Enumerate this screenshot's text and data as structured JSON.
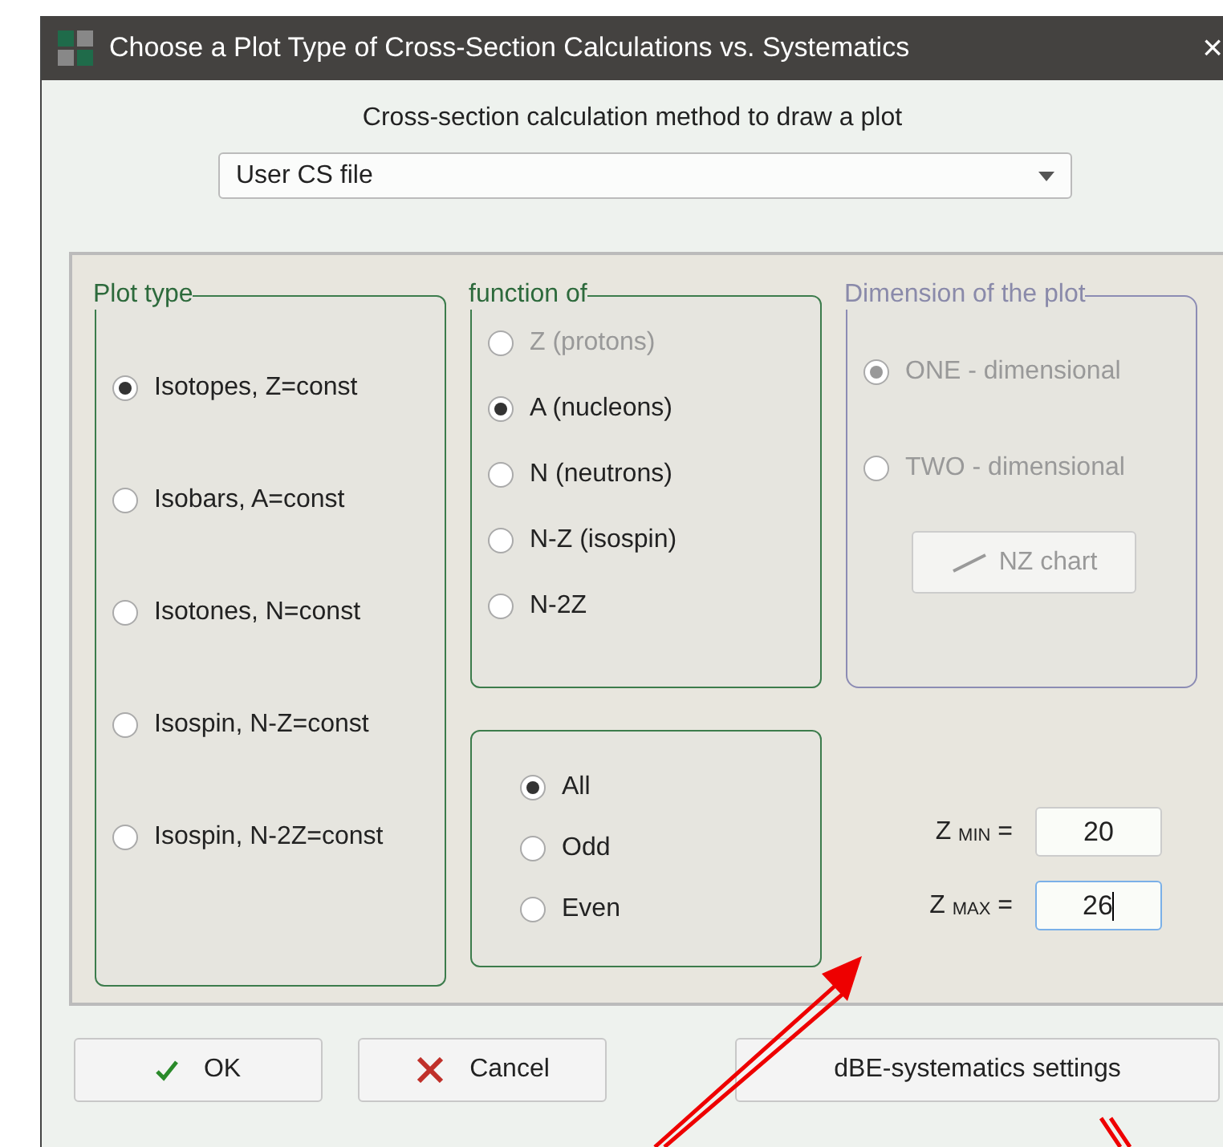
{
  "window": {
    "title": "Choose a Plot Type of Cross-Section Calculations vs. Systematics",
    "close": "×"
  },
  "method": {
    "label": "Cross-section calculation method to draw a plot",
    "value": "User CS file"
  },
  "plot_type": {
    "title": "Plot type",
    "options": [
      {
        "label": "Isotopes, Z=const",
        "selected": true,
        "disabled": false
      },
      {
        "label": "Isobars, A=const",
        "selected": false,
        "disabled": false
      },
      {
        "label": "Isotones, N=const",
        "selected": false,
        "disabled": false
      },
      {
        "label": "Isospin, N-Z=const",
        "selected": false,
        "disabled": false
      },
      {
        "label": "Isospin, N-2Z=const",
        "selected": false,
        "disabled": false
      }
    ]
  },
  "function_of": {
    "title": "function of",
    "options": [
      {
        "label": "Z (protons)",
        "selected": false,
        "disabled": true
      },
      {
        "label": "A (nucleons)",
        "selected": true,
        "disabled": false
      },
      {
        "label": "N (neutrons)",
        "selected": false,
        "disabled": false
      },
      {
        "label": "N-Z (isospin)",
        "selected": false,
        "disabled": false
      },
      {
        "label": "N-2Z",
        "selected": false,
        "disabled": false
      }
    ]
  },
  "parity": {
    "options": [
      {
        "label": "All",
        "selected": true,
        "disabled": false
      },
      {
        "label": "Odd",
        "selected": false,
        "disabled": false
      },
      {
        "label": "Even",
        "selected": false,
        "disabled": false
      }
    ]
  },
  "dimension": {
    "title": "Dimension of the plot",
    "disabled": true,
    "options": [
      {
        "label": "ONE - dimensional",
        "selected": true,
        "disabled": true
      },
      {
        "label": "TWO - dimensional",
        "selected": false,
        "disabled": true
      }
    ],
    "button": "NZ chart"
  },
  "z_range": [
    {
      "label": "Z $_{MIN}$ =",
      "value": "20",
      "focused": false
    },
    {
      "label": "Z $_{MAX}$ =",
      "value": "26",
      "focused": true
    }
  ],
  "buttons": [
    {
      "kind": "ok",
      "label": "OK"
    },
    {
      "kind": "cancel",
      "label": "Cancel"
    },
    {
      "kind": "plain",
      "label": "dBE-systematics settings"
    }
  ]
}
